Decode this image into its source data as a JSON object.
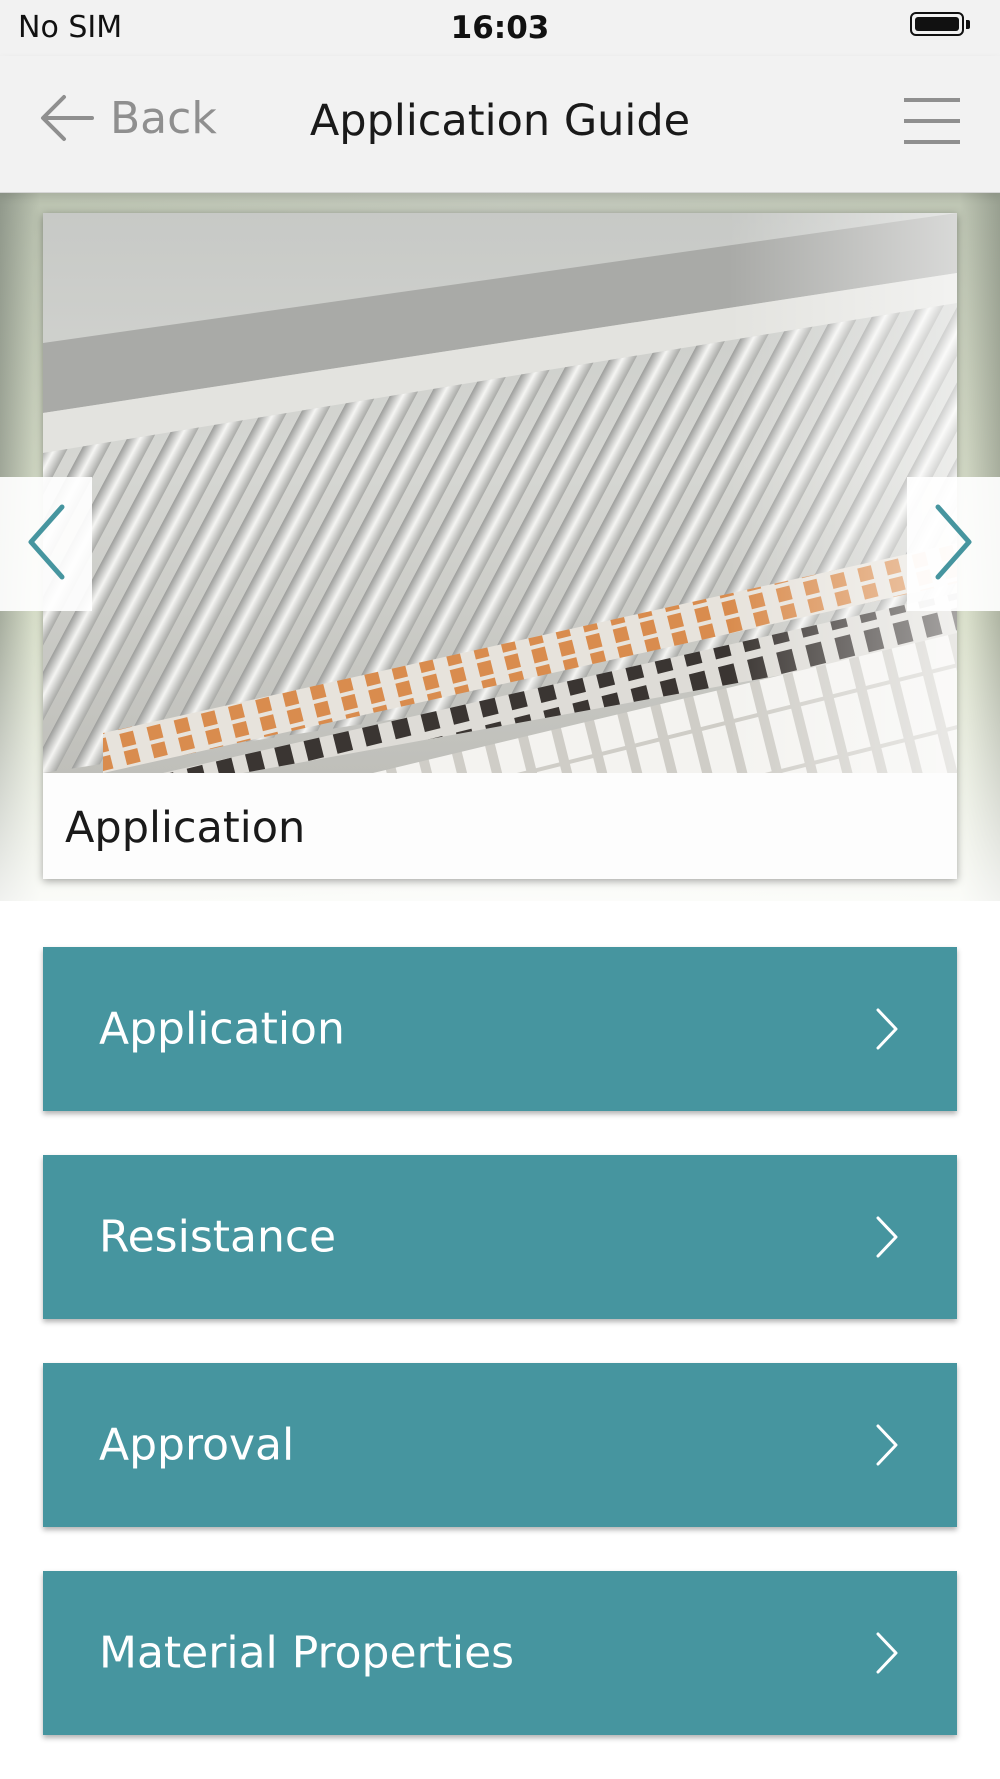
{
  "status_bar": {
    "carrier": "No SIM",
    "time": "16:03",
    "battery_icon": "battery-full-icon"
  },
  "nav": {
    "back_label": "Back",
    "title": "Application Guide",
    "back_icon": "arrow-left-icon",
    "menu_icon": "hamburger-menu-icon"
  },
  "carousel": {
    "slide_caption": "Application",
    "prev_icon": "chevron-left-icon",
    "next_icon": "chevron-right-icon"
  },
  "menu": {
    "items": [
      {
        "label": "Application"
      },
      {
        "label": "Resistance"
      },
      {
        "label": "Approval"
      },
      {
        "label": "Material Properties"
      }
    ]
  },
  "colors": {
    "accent_teal": "#46959f",
    "nav_background": "#f2f2f2",
    "muted_text": "#8f8f8f"
  }
}
